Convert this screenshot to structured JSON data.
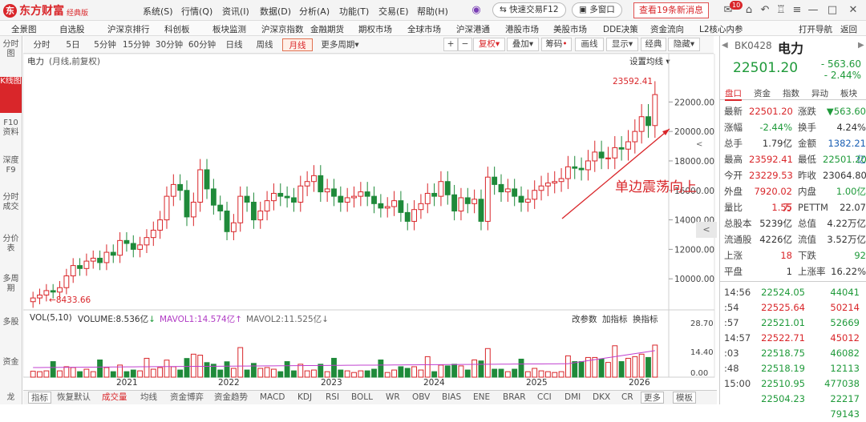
{
  "app": {
    "brand": "东方财富",
    "edition": "经典版",
    "logo_letter": "东"
  },
  "menu": [
    "系统(S)",
    "行情(Q)",
    "资讯(I)",
    "数据(D)",
    "分析(A)",
    "功能(T)",
    "交易(E)",
    "帮助(H)"
  ],
  "quick_trade": "快速交易F12",
  "multi_window": "多窗口",
  "news_button": "查看19条新消息",
  "news_badge": "10",
  "nav": [
    "全景图",
    "自选股",
    "沪深京排行",
    "科创板",
    "板块监测",
    "沪深京指数",
    "金融期货",
    "期权市场",
    "全球市场",
    "沪深港通",
    "港股市场",
    "美股市场",
    "DDE决策",
    "资金流向",
    "L2核心内参"
  ],
  "nav_right": [
    "打开导航",
    "返回"
  ],
  "left_rail": [
    {
      "label": "分时图",
      "active": false
    },
    {
      "label": "K线图",
      "active": true
    },
    {
      "label": "F10资料",
      "active": false
    },
    {
      "label": "深度F9",
      "active": false
    },
    {
      "label": "分时成交",
      "active": false
    },
    {
      "label": "分价表",
      "active": false
    },
    {
      "label": "多周期",
      "active": false
    },
    {
      "label": "多股",
      "active": false
    },
    {
      "label": "资金",
      "active": false
    },
    {
      "label": "龙",
      "active": false
    }
  ],
  "periods": [
    {
      "label": "分时",
      "sel": false
    },
    {
      "label": "5日",
      "sel": false
    },
    {
      "label": "5分钟",
      "sel": false
    },
    {
      "label": "15分钟",
      "sel": false
    },
    {
      "label": "30分钟",
      "sel": false
    },
    {
      "label": "60分钟",
      "sel": false
    },
    {
      "label": "日线",
      "sel": false
    },
    {
      "label": "周线",
      "sel": false
    },
    {
      "label": "月线",
      "sel": true
    },
    {
      "label": "更多周期",
      "sel": false
    }
  ],
  "toolbar": {
    "plus": "+",
    "minus": "−",
    "adjust": "复权",
    "overlay": "叠加",
    "stat": "筹码",
    "draw": "画线",
    "display": "显示",
    "classic": "经典",
    "hide": "隐藏"
  },
  "chart_header": {
    "name": "电力",
    "mode": "(月线,前复权)",
    "ma_setting": "设置均线"
  },
  "chart_data": {
    "type": "candlestick",
    "title": "电力",
    "y_ticks": [
      10000.0,
      12000.0,
      14000.0,
      16000.0,
      18000.0,
      20000.0,
      22000.0
    ],
    "ylim": [
      8000,
      24300
    ],
    "x_labels": [
      "2021",
      "2022",
      "2023",
      "2024",
      "2025",
      "2026"
    ],
    "high_label": "23592.41",
    "low_label": "8433.66",
    "annotation": "单边震荡向上",
    "volume": {
      "title": "VOL(5,10)",
      "volume": "VOLUME:8.536亿",
      "ma1": "MAVOL1:14.574亿",
      "ma2": "MAVOL2:11.525亿",
      "y_ticks": [
        "28.70",
        "14.40",
        "0.00"
      ],
      "ylim": [
        0,
        30
      ],
      "buttons": [
        "改参数",
        "加指标",
        "换指标"
      ]
    }
  },
  "bottom_tabs": [
    {
      "label": "指标",
      "sel": false
    },
    {
      "label": "恢复默认",
      "sel": false
    },
    {
      "label": "成交量",
      "sel": true
    },
    {
      "label": "均线",
      "sel": false
    },
    {
      "label": "资金博弈",
      "sel": false
    },
    {
      "label": "资金趋势",
      "sel": false
    },
    {
      "label": "MACD",
      "sel": false
    },
    {
      "label": "KDJ",
      "sel": false
    },
    {
      "label": "RSI",
      "sel": false
    },
    {
      "label": "BOLL",
      "sel": false
    },
    {
      "label": "WR",
      "sel": false
    },
    {
      "label": "OBV",
      "sel": false
    },
    {
      "label": "BIAS",
      "sel": false
    },
    {
      "label": "ENE",
      "sel": false
    },
    {
      "label": "BRAR",
      "sel": false
    },
    {
      "label": "CCI",
      "sel": false
    },
    {
      "label": "DMI",
      "sel": false
    },
    {
      "label": "DKX",
      "sel": false
    },
    {
      "label": "CR",
      "sel": false
    },
    {
      "label": "更多",
      "sel": false
    },
    {
      "label": "模板",
      "sel": false
    }
  ],
  "quote": {
    "code": "BK0428",
    "name": "电力",
    "price": "22501.20",
    "change": "- 563.60",
    "pct": "- 2.44%",
    "tabs": [
      "盘口",
      "资金",
      "指数",
      "异动",
      "板块"
    ],
    "rows": [
      [
        [
          "最新",
          "22501.20",
          "r"
        ],
        [
          "涨跌",
          "▼563.60",
          "g"
        ]
      ],
      [
        [
          "涨幅",
          "-2.44%",
          "g"
        ],
        [
          "换手",
          "4.24%",
          "k"
        ]
      ],
      [
        [
          "总手",
          "1.79亿",
          "k"
        ],
        [
          "金额",
          "1382.21亿",
          "b"
        ]
      ],
      [
        [
          "最高",
          "23592.41",
          "r"
        ],
        [
          "最低",
          "22501.20",
          "g"
        ]
      ],
      [
        [
          "今开",
          "23229.53",
          "r"
        ],
        [
          "昨收",
          "23064.80",
          "k"
        ]
      ],
      [
        [
          "外盘",
          "7920.02万",
          "r"
        ],
        [
          "内盘",
          "1.00亿",
          "g"
        ]
      ],
      [
        [
          "量比",
          "1.55",
          "r"
        ],
        [
          "PETTM",
          "22.07",
          "k"
        ]
      ],
      [
        [
          "总股本",
          "5239亿",
          "k"
        ],
        [
          "总值",
          "4.22万亿",
          "k"
        ]
      ],
      [
        [
          "流通股",
          "4226亿",
          "k"
        ],
        [
          "流值",
          "3.52万亿",
          "k"
        ]
      ],
      [
        [
          "上涨",
          "18",
          "r"
        ],
        [
          "下跌",
          "92",
          "g"
        ]
      ],
      [
        [
          "平盘",
          "1",
          "k"
        ],
        [
          "上涨率",
          "16.22%",
          "k"
        ]
      ]
    ],
    "ticks": [
      [
        "14:56",
        "22524.05",
        "44041",
        "g"
      ],
      [
        ":54",
        "22525.64",
        "50214",
        "r"
      ],
      [
        ":57",
        "22521.01",
        "52669",
        "g"
      ],
      [
        "14:57",
        "22522.71",
        "45012",
        "r"
      ],
      [
        ":03",
        "22518.75",
        "46082",
        "g"
      ],
      [
        ":48",
        "22518.19",
        "12113",
        "g"
      ],
      [
        "15:00",
        "22510.95",
        "477038",
        "g"
      ],
      [
        "",
        "22504.23",
        "22217",
        "g"
      ],
      [
        "",
        "",
        "79143",
        "g"
      ]
    ]
  }
}
